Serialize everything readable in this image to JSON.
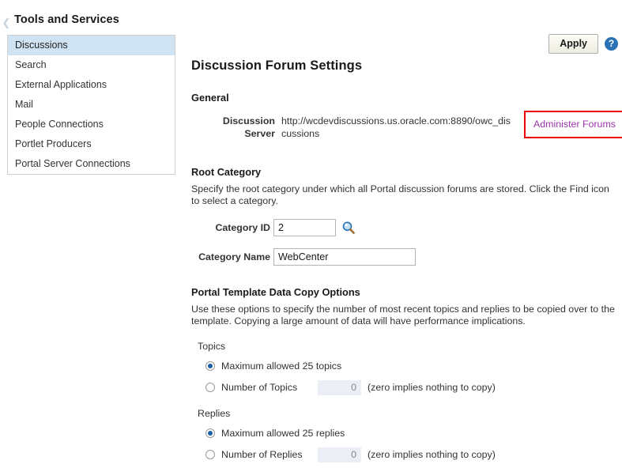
{
  "header": {
    "title": "Tools and Services",
    "collapse_icon": "chevron-left-icon"
  },
  "sidebar": {
    "items": [
      {
        "label": "Discussions",
        "selected": true
      },
      {
        "label": "Search",
        "selected": false
      },
      {
        "label": "External Applications",
        "selected": false
      },
      {
        "label": "Mail",
        "selected": false
      },
      {
        "label": "People Connections",
        "selected": false
      },
      {
        "label": "Portlet Producers",
        "selected": false
      },
      {
        "label": "Portal Server Connections",
        "selected": false
      }
    ]
  },
  "actions": {
    "apply_label": "Apply",
    "help_glyph": "?",
    "help_icon": "help-circle-icon"
  },
  "main": {
    "page_title": "Discussion Forum Settings",
    "general": {
      "heading": "General",
      "server_label": "Discussion Server",
      "server_value": "http://wcdevdiscussions.us.oracle.com:8890/owc_discussions",
      "administer_link": "Administer Forums"
    },
    "root_category": {
      "heading": "Root Category",
      "description": "Specify the root category under which all Portal discussion forums are stored. Click the Find icon to select a category.",
      "category_id_label": "Category ID",
      "category_id_value": "2",
      "find_icon": "magnifier-icon",
      "category_name_label": "Category Name",
      "category_name_value": "WebCenter"
    },
    "copy_options": {
      "heading": "Portal Template Data Copy Options",
      "description": "Use these options to specify the number of most recent topics and replies to be copied over to the template. Copying a large amount of data will have performance implications.",
      "topics": {
        "group_label": "Topics",
        "max_label": "Maximum allowed 25 topics",
        "max_selected": true,
        "number_label": "Number of Topics",
        "number_value": "0",
        "number_selected": false,
        "hint": "(zero implies nothing to copy)"
      },
      "replies": {
        "group_label": "Replies",
        "max_label": "Maximum allowed 25 replies",
        "max_selected": true,
        "number_label": "Number of Replies",
        "number_value": "0",
        "number_selected": false,
        "hint": "(zero implies nothing to copy)"
      }
    }
  },
  "colors": {
    "selected_nav": "#cfe3f2",
    "link_visited": "#9933aa",
    "highlight_box": "#ee0000",
    "radio_dot": "#1a5fa8",
    "help_blue": "#2a72b5"
  }
}
